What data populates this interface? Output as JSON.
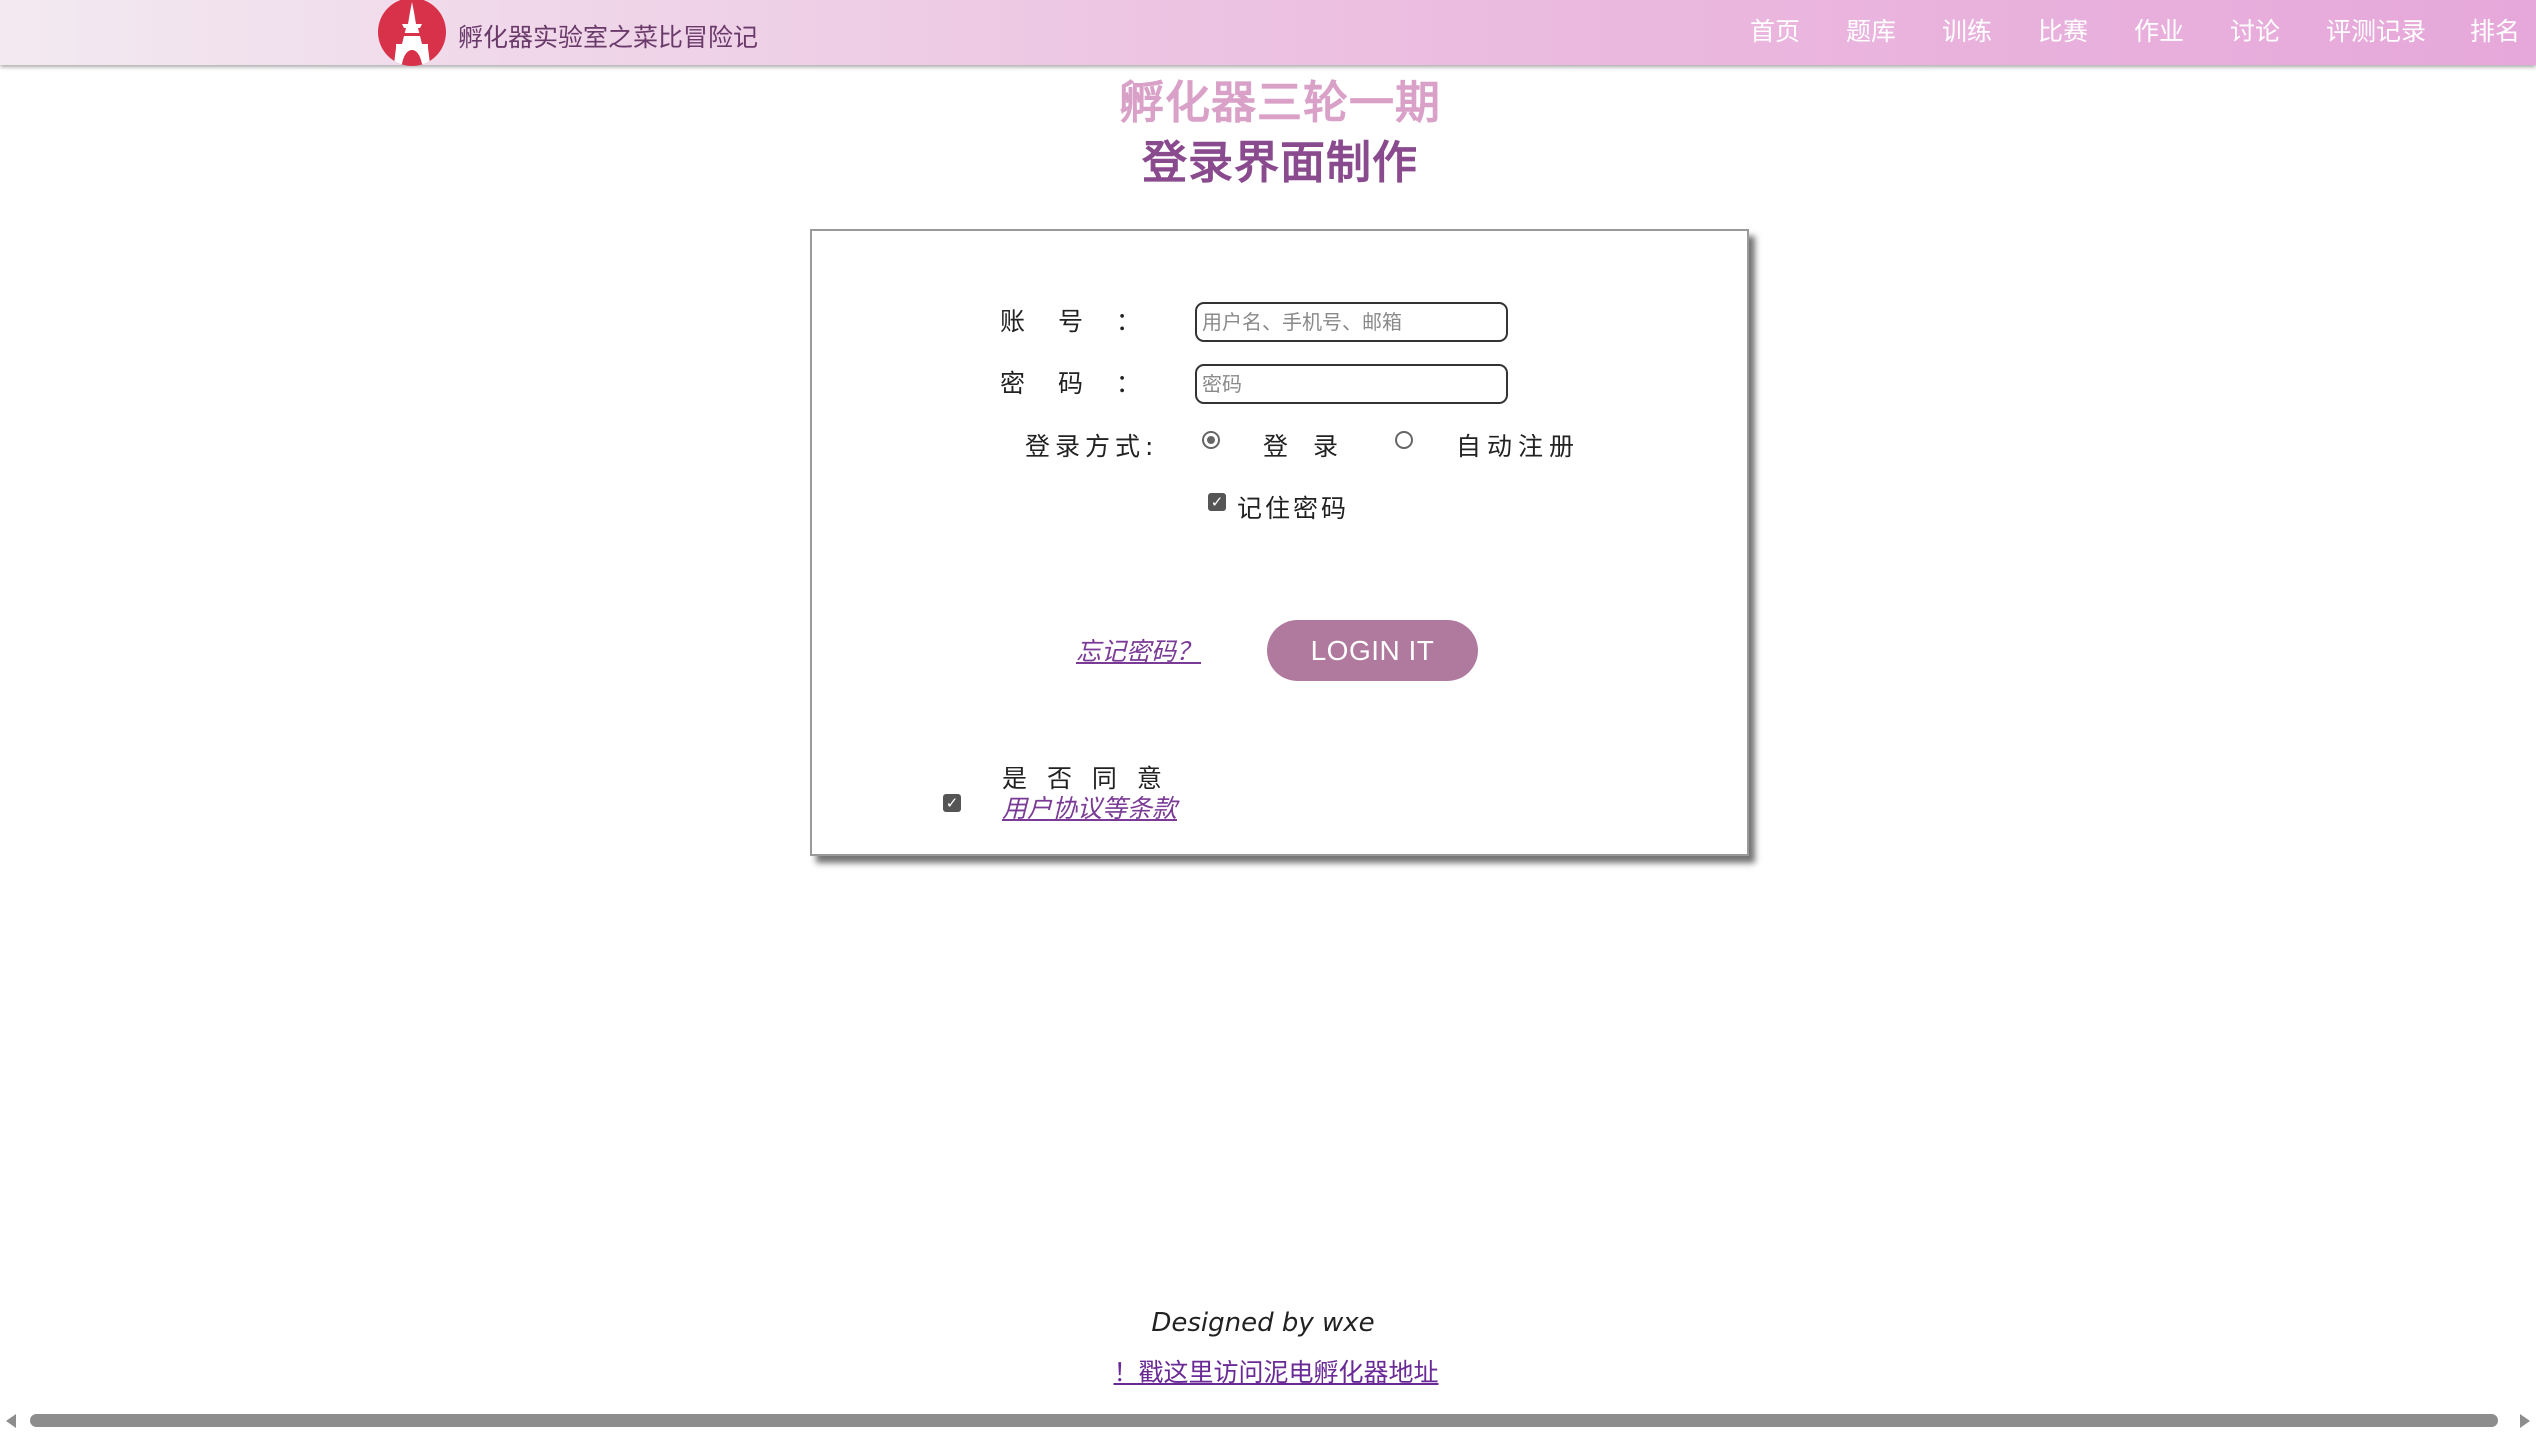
{
  "header": {
    "brand": "孵化器实验室之菜比冒险记",
    "nav": [
      "首页",
      "题库",
      "训练",
      "比赛",
      "作业",
      "讨论",
      "评测记录",
      "排名"
    ]
  },
  "heading": {
    "line1": "孵化器三轮一期",
    "line2": "登录界面制作"
  },
  "form": {
    "account_label": "账　 号　 ：",
    "account_placeholder": "用户名、手机号、邮箱",
    "password_label": "密　 码　 ：",
    "password_placeholder": "密码",
    "login_method_label": "登录方式:",
    "radio_login": "登　录",
    "radio_auto_register": "自动注册",
    "radio_selected": "login",
    "remember_label": "记住密码",
    "remember_checked": true,
    "forgot_link": "忘记密码？",
    "login_button": "LOGIN IT",
    "agree_label": "是 否 同 意",
    "terms_link": "用户协议等条款",
    "agree_checked": true
  },
  "footer": {
    "designed_by": "Designed by wxe",
    "visit_link": "！戳这里访问泥电孵化器地址"
  },
  "colors": {
    "accent": "#b07a9e",
    "heading_light": "#d9a0c8",
    "heading_dark": "#8a4a8e",
    "logo": "#d8314a"
  }
}
